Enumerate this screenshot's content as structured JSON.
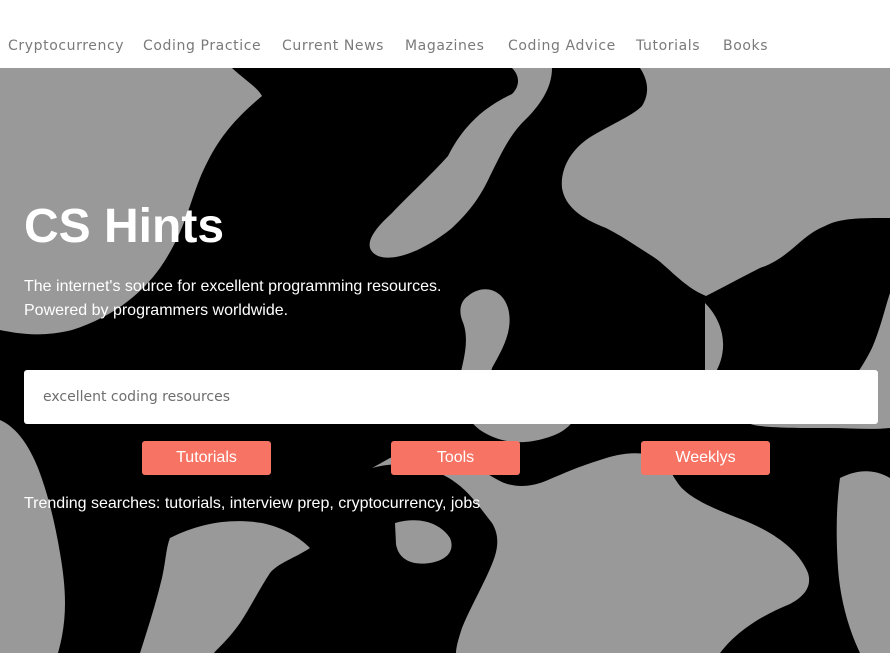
{
  "nav": {
    "items": [
      {
        "label": "Cryptocurrency"
      },
      {
        "label": "Coding Practice"
      },
      {
        "label": "Current News"
      },
      {
        "label": "Magazines"
      },
      {
        "label": "Coding Advice"
      },
      {
        "label": "Tutorials"
      },
      {
        "label": "Books"
      }
    ]
  },
  "hero": {
    "title": "CS Hints",
    "subtitle_line1": "The internet's source for excellent programming resources.",
    "subtitle_line2": "Powered by programmers worldwide."
  },
  "search": {
    "placeholder": "excellent coding resources"
  },
  "buttons": {
    "tutorials": "Tutorials",
    "tools": "Tools",
    "weeklys": "Weeklys"
  },
  "trending": {
    "prefix": "Trending searches: ",
    "items": [
      "tutorials",
      "interview prep",
      "cryptocurrency",
      "jobs"
    ],
    "separator": ", "
  },
  "colors": {
    "accent": "#f77465",
    "hero_dark": "#000000",
    "hero_light": "#999999",
    "nav_text": "#7a7a7a"
  }
}
